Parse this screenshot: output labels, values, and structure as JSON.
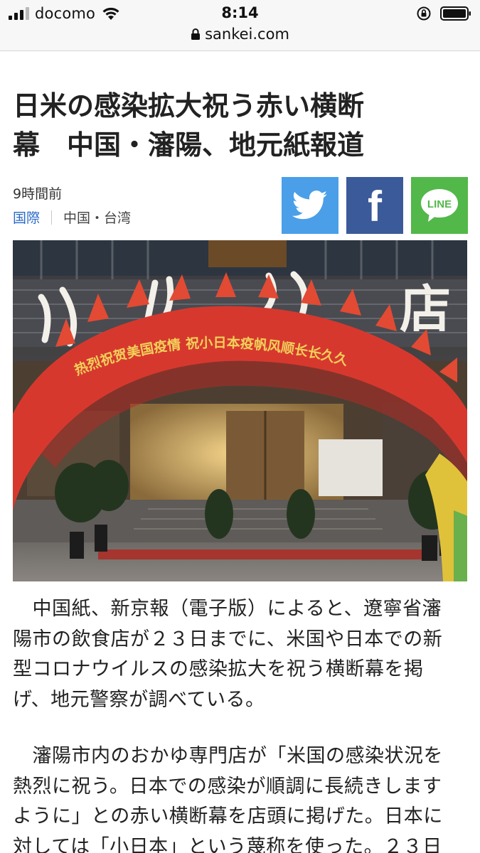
{
  "status_bar": {
    "carrier": "docomo",
    "time": "8:14",
    "url": "sankei.com"
  },
  "article": {
    "title": "日米の感染拡大祝う赤い横断\n幕　中国・瀋陽、地元紙報道",
    "time_ago": "9時間前",
    "category": "国際",
    "subcategory": "中国・台湾",
    "share": {
      "facebook_letter": "f",
      "line_label": "LINE"
    },
    "photo": {
      "banner_text": "热烈祝贺美国疫情 祝小日本疫帆风顺长长久久",
      "sign_text": "店"
    },
    "paragraphs": [
      "　中国紙、新京報（電子版）によると、遼寧省瀋\n陽市の飲食店が２３日までに、米国や日本での新\n型コロナウイルスの感染拡大を祝う横断幕を掲\nげ、地元警察が調べている。",
      "　瀋陽市内のおかゆ専門店が「米国の感染状況を\n熱烈に祝う。日本での感染が順調に長続きします\nように」との赤い横断幕を店頭に掲げた。日本に\n対しては「小日本」という蔑称を使った。２３日"
    ]
  },
  "colors": {
    "twitter": "#4a9fe8",
    "facebook": "#3b5a9a",
    "line": "#52b84a",
    "link": "#2a69c9"
  },
  "icons": [
    "signal-icon",
    "wifi-icon",
    "rotation-lock-icon",
    "battery-icon",
    "padlock-icon",
    "twitter-bird-icon",
    "facebook-icon",
    "line-icon"
  ]
}
